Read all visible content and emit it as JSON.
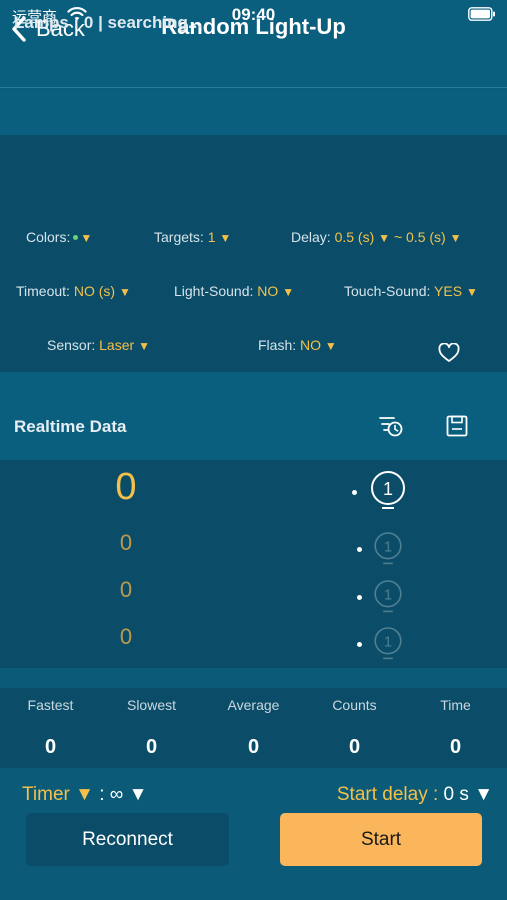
{
  "status_bar": {
    "carrier": "运营商",
    "time": "09:40"
  },
  "nav": {
    "back_label": "Back",
    "title": "Random Light-Up"
  },
  "lamps": {
    "text": "Lamps : 0 | searching..."
  },
  "settings": {
    "colors_label": "Colors:",
    "targets_label": "Targets:",
    "targets_value": "1",
    "delay_label": "Delay:",
    "delay_min": "0.5 (s)",
    "delay_sep": "~",
    "delay_max": "0.5 (s)",
    "timeout_label": "Timeout:",
    "timeout_value": "NO (s)",
    "light_sound_label": "Light-Sound:",
    "light_sound_value": "NO",
    "touch_sound_label": "Touch-Sound:",
    "touch_sound_value": "YES",
    "sensor_label": "Sensor:",
    "sensor_value": "Laser",
    "flash_label": "Flash:",
    "flash_value": "NO",
    "arrow": "▼"
  },
  "realtime": {
    "title": "Realtime Data",
    "values": [
      "0",
      "0",
      "0",
      "0"
    ],
    "lamp_numbers": [
      "1",
      "1",
      "1",
      "1"
    ]
  },
  "stats": [
    {
      "label": "Fastest",
      "value": "0"
    },
    {
      "label": "Slowest",
      "value": "0"
    },
    {
      "label": "Average",
      "value": "0"
    },
    {
      "label": "Counts",
      "value": "0"
    },
    {
      "label": "Time",
      "value": "0"
    }
  ],
  "bottom": {
    "timer_label": "Timer",
    "timer_sep": ":",
    "timer_value": "∞",
    "start_delay_label": "Start delay :",
    "start_delay_value": "0 s",
    "arrow": "▼",
    "reconnect_label": "Reconnect",
    "start_label": "Start"
  },
  "colors": {
    "background": "#0a5a78",
    "panel": "#0b4d68",
    "accent": "#f4c04a",
    "start_button": "#fbb65b",
    "color_dot": "#6ad07a"
  },
  "icons": {
    "wifi": "wifi-icon",
    "battery": "battery-icon",
    "back": "chevron-left-icon",
    "favorite": "heart-icon",
    "history": "history-icon",
    "save": "save-icon",
    "lamp": "lightbulb-icon"
  }
}
